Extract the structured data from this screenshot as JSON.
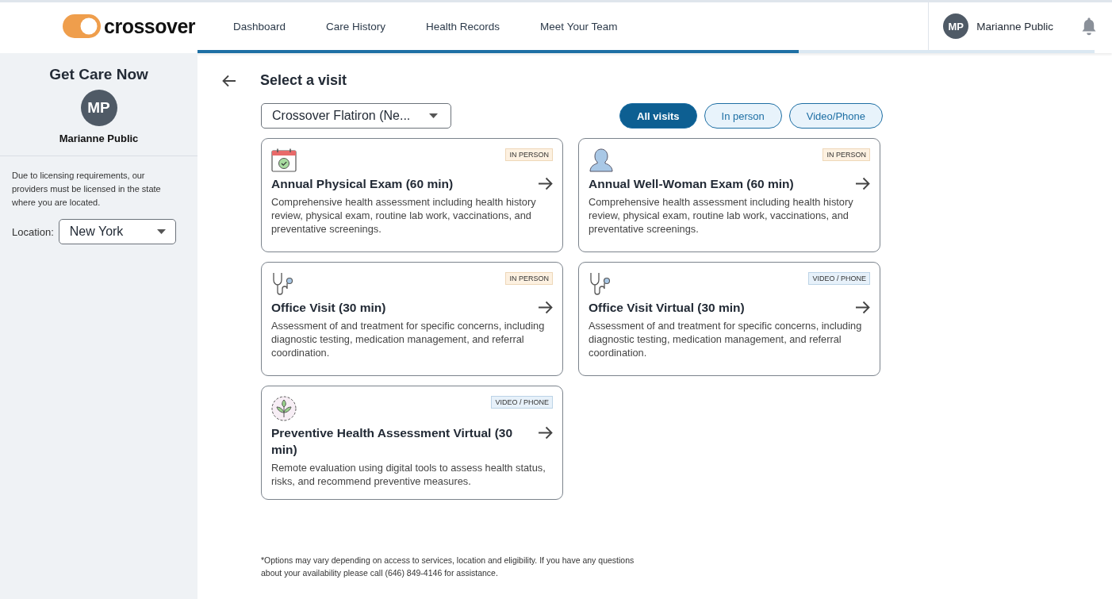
{
  "header": {
    "logo": "crossover",
    "nav": [
      {
        "label": "Dashboard",
        "selected": false
      },
      {
        "label": "Care History",
        "selected": false
      },
      {
        "label": "Health Records",
        "selected": false
      },
      {
        "label": "Meet Your Team",
        "selected": false
      }
    ],
    "user": {
      "initials": "MP",
      "name": "Marianne Public"
    },
    "progress": {
      "level": 0.67
    }
  },
  "sidebar": {
    "title": "Get Care Now",
    "initials": "MP",
    "name": "Marianne Public",
    "notice": "Due to licensing requirements, our providers must be licensed in the state where you are located.",
    "location_label": "Location:",
    "location_value": "New York"
  },
  "main": {
    "title": "Select a visit",
    "clinic": "Crossover Flatiron (Ne...",
    "filters": [
      {
        "label": "All visits",
        "selected": true
      },
      {
        "label": "In person",
        "selected": false
      },
      {
        "label": "Video/Phone",
        "selected": false
      }
    ],
    "visits": [
      {
        "kind": "calendar",
        "badge": {
          "label": "IN PERSON",
          "kind": "in_person"
        },
        "title": "Annual Physical Exam (60 min)",
        "description": "Comprehensive health assessment including health history review, physical exam, routine lab work, vaccinations, and preventative screenings."
      },
      {
        "kind": "woman",
        "badge": {
          "label": "IN PERSON",
          "kind": "in_person"
        },
        "title": "Annual Well-Woman Exam (60 min)",
        "description": "Comprehensive health assessment including health history review, physical exam, routine lab work, vaccinations, and preventative screenings."
      },
      {
        "kind": "stethoscope",
        "badge": {
          "label": "IN PERSON",
          "kind": "in_person"
        },
        "title": "Office Visit (30 min)",
        "description": "Assessment of and treatment for specific concerns, including diagnostic testing, medication management, and referral coordination."
      },
      {
        "kind": "stethoscope",
        "badge": {
          "label": "VIDEO / PHONE",
          "kind": "video"
        },
        "title": "Office Visit Virtual (30 min)",
        "description": "Assessment of and treatment for specific concerns, including diagnostic testing, medication management, and referral coordination."
      },
      {
        "kind": "plant",
        "badge": {
          "label": "VIDEO / PHONE",
          "kind": "video"
        },
        "title": "Preventive Health Assessment Virtual (30 min)",
        "description": "Remote evaluation using digital tools to assess health status, risks, and recommend preventive measures."
      }
    ],
    "footnote": "*Options may vary depending on access to services, location and eligibility. If you have any questions about your availability please call (646) 849-4146 for assistance."
  }
}
